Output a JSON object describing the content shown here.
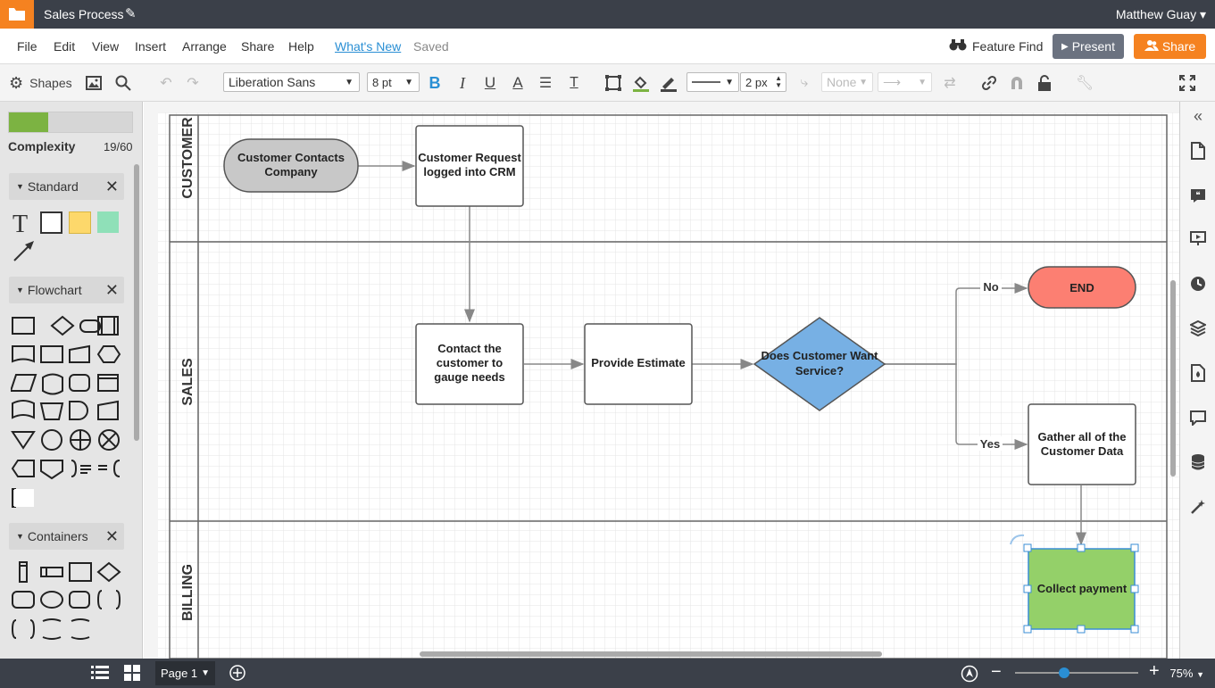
{
  "app": {
    "doc_title": "Sales Process",
    "user": "Matthew Guay",
    "accent": "#f58220"
  },
  "menu": {
    "items": [
      "File",
      "Edit",
      "View",
      "Insert",
      "Arrange",
      "Share",
      "Help"
    ],
    "whats_new": "What's New",
    "saved": "Saved",
    "feature_find": "Feature Find",
    "present": "Present",
    "share": "Share"
  },
  "toolbar": {
    "shapes_label": "Shapes",
    "font": "Liberation Sans",
    "font_size": "8 pt",
    "line_width": "2 px",
    "arrow_none": "None"
  },
  "left_panel": {
    "complexity_label": "Complexity",
    "complexity_value": "19/60",
    "complexity_fraction": 0.317,
    "sections": [
      {
        "title": "Standard"
      },
      {
        "title": "Flowchart"
      },
      {
        "title": "Containers"
      }
    ]
  },
  "diagram": {
    "lanes": [
      "CUSTOMER",
      "SALES",
      "BILLING"
    ],
    "nodes": {
      "customer_contacts": "Customer Contacts Company",
      "request_logged": "Customer Request logged into CRM",
      "contact_customer": "Contact the customer to gauge needs",
      "provide_estimate": "Provide Estimate",
      "decision": "Does Customer Want Service?",
      "end": "END",
      "gather_data": "Gather all of the Customer Data",
      "collect_payment": "Collect payment"
    },
    "edge_labels": {
      "no": "No",
      "yes": "Yes"
    },
    "colors": {
      "terminal": "#c8c8c8",
      "decision": "#77b0e4",
      "end": "#fc7f72",
      "payment": "#94d069"
    }
  },
  "bottom": {
    "page_label": "Page 1",
    "zoom": "75%",
    "zoom_fraction": 0.4
  }
}
